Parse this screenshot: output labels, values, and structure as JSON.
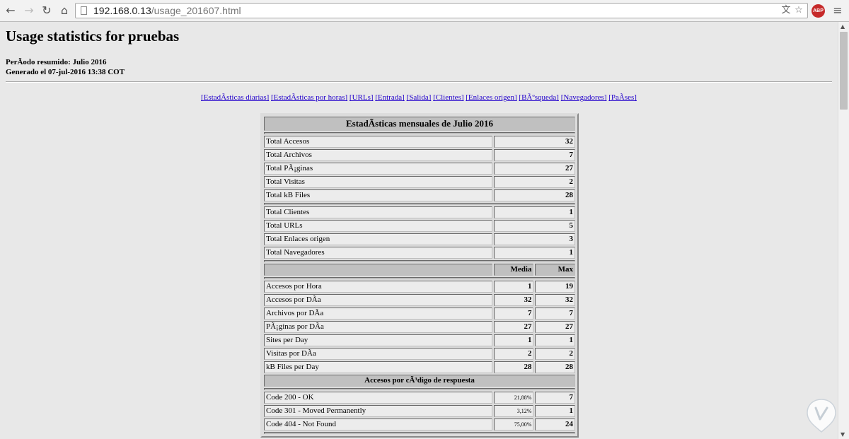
{
  "browser": {
    "url_host": "192.168.0.13",
    "url_path": "/usage_201607.html"
  },
  "page": {
    "title": "Usage statistics for pruebas",
    "period_line": "PerÃodo resumido: Julio 2016",
    "generated_line": "Generado el 07-jul-2016 13:38 COT",
    "nav_links": [
      "[EstadÃsticas diarias]",
      "[EstadÃsticas por horas]",
      "[URLs]",
      "[Entrada]",
      "[Salida]",
      "[Clientes]",
      "[Enlaces origen]",
      "[BÃºsqueda]",
      "[Navegadores]",
      "[PaÃses]"
    ]
  },
  "stats": {
    "title": "EstadÃsticas mensuales de Julio 2016",
    "group1": [
      {
        "label": "Total Accesos",
        "value": "32"
      },
      {
        "label": "Total Archivos",
        "value": "7"
      },
      {
        "label": "Total PÃ¡ginas",
        "value": "27"
      },
      {
        "label": "Total Visitas",
        "value": "2"
      },
      {
        "label": "Total kB Files",
        "value": "28"
      }
    ],
    "group2": [
      {
        "label": "Total Clientes",
        "value": "1"
      },
      {
        "label": "Total URLs",
        "value": "5"
      },
      {
        "label": "Total Enlaces origen",
        "value": "3"
      },
      {
        "label": "Total Navegadores",
        "value": "1"
      }
    ],
    "col_media": "Media",
    "col_max": "Max",
    "group3": [
      {
        "label": "Accesos por Hora",
        "media": "1",
        "max": "19"
      },
      {
        "label": "Accesos por DÃa",
        "media": "32",
        "max": "32"
      },
      {
        "label": "Archivos por DÃa",
        "media": "7",
        "max": "7"
      },
      {
        "label": "PÃ¡ginas por DÃa",
        "media": "27",
        "max": "27"
      },
      {
        "label": "Sites per Day",
        "media": "1",
        "max": "1"
      },
      {
        "label": "Visitas por DÃa",
        "media": "2",
        "max": "2"
      },
      {
        "label": "kB Files per Day",
        "media": "28",
        "max": "28"
      }
    ],
    "codes_title": "Accesos por cÃ³digo de respuesta",
    "codes": [
      {
        "label": "Code 200 - OK",
        "pct": "21,88%",
        "value": "7"
      },
      {
        "label": "Code 301 - Moved Permanently",
        "pct": "3,12%",
        "value": "1"
      },
      {
        "label": "Code 404 - Not Found",
        "pct": "75,00%",
        "value": "24"
      }
    ]
  }
}
